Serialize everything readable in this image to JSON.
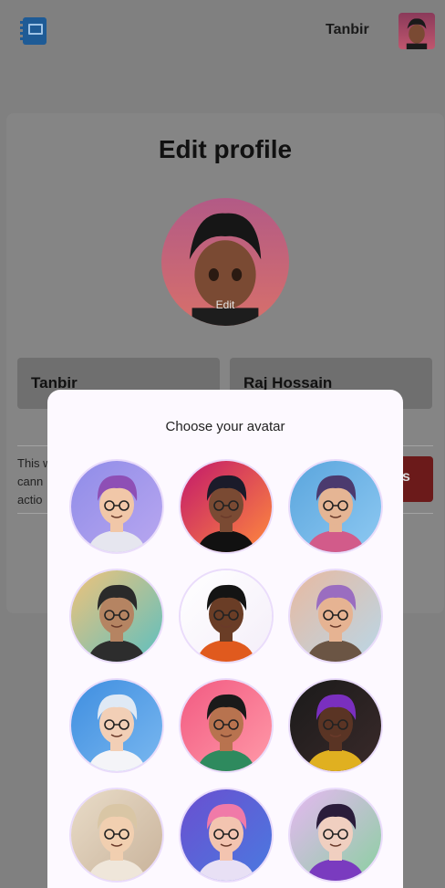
{
  "header": {
    "username": "Tanbir"
  },
  "profile": {
    "title": "Edit profile",
    "edit_label": "Edit",
    "first_name": "Tanbir",
    "last_name": "Raj Hossain",
    "warning_text": "This w\ncann\nactio",
    "delete_button_label": "s"
  },
  "modal": {
    "title": "Choose your avatar",
    "avatars": [
      {
        "name": "avatar-option-1",
        "bg": "#8f8ce8",
        "bg2": "#b9a7f0",
        "skin": "#f1c7a8",
        "hair": "#8e4fb5",
        "shirt": "#e6e6ef"
      },
      {
        "name": "avatar-option-2",
        "bg": "#c2186b",
        "bg2": "#ff8a3d",
        "skin": "#7a4a33",
        "hair": "#1b1b2a",
        "shirt": "#111111"
      },
      {
        "name": "avatar-option-3",
        "bg": "#5aa5dd",
        "bg2": "#8ec9f2",
        "skin": "#e5b594",
        "hair": "#4b3a6e",
        "shirt": "#d25b8a"
      },
      {
        "name": "avatar-option-4",
        "bg": "#f0c27a",
        "bg2": "#5cc0c0",
        "skin": "#b58462",
        "hair": "#2a2a2a",
        "shirt": "#2d2d2d"
      },
      {
        "name": "avatar-option-5",
        "bg": "#ffffff",
        "bg2": "#f4eef9",
        "skin": "#6a3d26",
        "hair": "#141414",
        "shirt": "#e05a1e"
      },
      {
        "name": "avatar-option-6",
        "bg": "#e8b9a0",
        "bg2": "#b9d7e8",
        "skin": "#e6b392",
        "hair": "#9a6dc0",
        "shirt": "#6b5544"
      },
      {
        "name": "avatar-option-7",
        "bg": "#3f8ee0",
        "bg2": "#7ab8f0",
        "skin": "#f2cfb6",
        "hair": "#dfe9f5",
        "shirt": "#f4f4f8"
      },
      {
        "name": "avatar-option-8",
        "bg": "#f25a82",
        "bg2": "#ff9aa8",
        "skin": "#b8734f",
        "hair": "#1a1a1a",
        "shirt": "#2e8a5e"
      },
      {
        "name": "avatar-option-9",
        "bg": "#1a1a1a",
        "bg2": "#3a2a2a",
        "skin": "#5a3424",
        "hair": "#7a2fbf",
        "shirt": "#e0b020"
      },
      {
        "name": "avatar-option-10",
        "bg": "#e9dcc8",
        "bg2": "#c8b29a",
        "skin": "#f1cfb0",
        "hair": "#d9c6a5",
        "shirt": "#efe6da"
      },
      {
        "name": "avatar-option-11",
        "bg": "#6a4fd0",
        "bg2": "#4a7ae0",
        "skin": "#f3c4b0",
        "hair": "#f07aa8",
        "shirt": "#e8e0f5"
      },
      {
        "name": "avatar-option-12",
        "bg": "#e6b8f2",
        "bg2": "#8ad0a0",
        "skin": "#f0cfc0",
        "hair": "#2a1c3a",
        "shirt": "#7a3bbf"
      }
    ]
  },
  "colors": {
    "overlay": "#808080",
    "modal_bg": "#fdf9ff",
    "avatar_ring": "#eadcfb"
  }
}
